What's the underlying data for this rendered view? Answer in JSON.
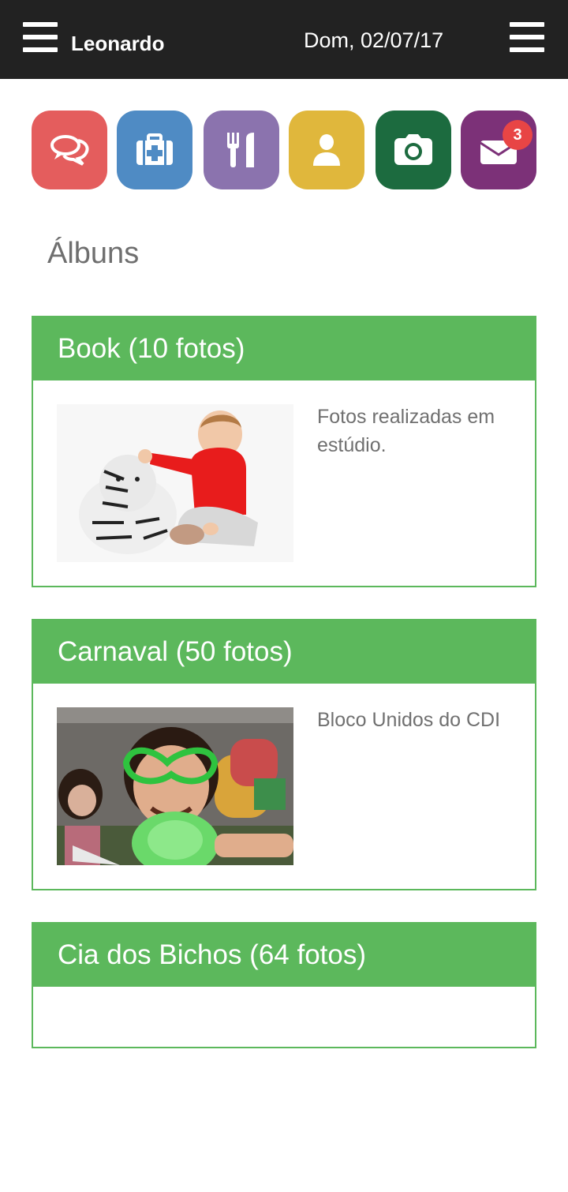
{
  "header": {
    "username": "Leonardo",
    "date": "Dom, 02/07/17",
    "left_menu_icon": "hamburger-menu-icon",
    "right_menu_icon": "hamburger-menu-icon"
  },
  "apps": [
    {
      "icon": "chat-bubbles-icon",
      "color": "#e45d5d"
    },
    {
      "icon": "first-aid-kit-icon",
      "color": "#4f8bc4"
    },
    {
      "icon": "fork-knife-icon",
      "color": "#8b73ae"
    },
    {
      "icon": "user-icon",
      "color": "#e0b73c"
    },
    {
      "icon": "camera-icon",
      "color": "#1c6b3f"
    },
    {
      "icon": "envelope-icon",
      "color": "#7c3178",
      "badge": "3",
      "badge_color": "#e84545"
    }
  ],
  "section_title": "Álbuns",
  "albums": [
    {
      "title": "Book (10 fotos)",
      "description": "Fotos realizadas em estúdio."
    },
    {
      "title": "Carnaval (50 fotos)",
      "description": "Bloco Unidos do CDI"
    },
    {
      "title": "Cia dos Bichos (64 fotos)",
      "description": ""
    }
  ],
  "colors": {
    "topbar": "#222222",
    "album_green": "#5cb85c",
    "text_gray": "#707070"
  }
}
